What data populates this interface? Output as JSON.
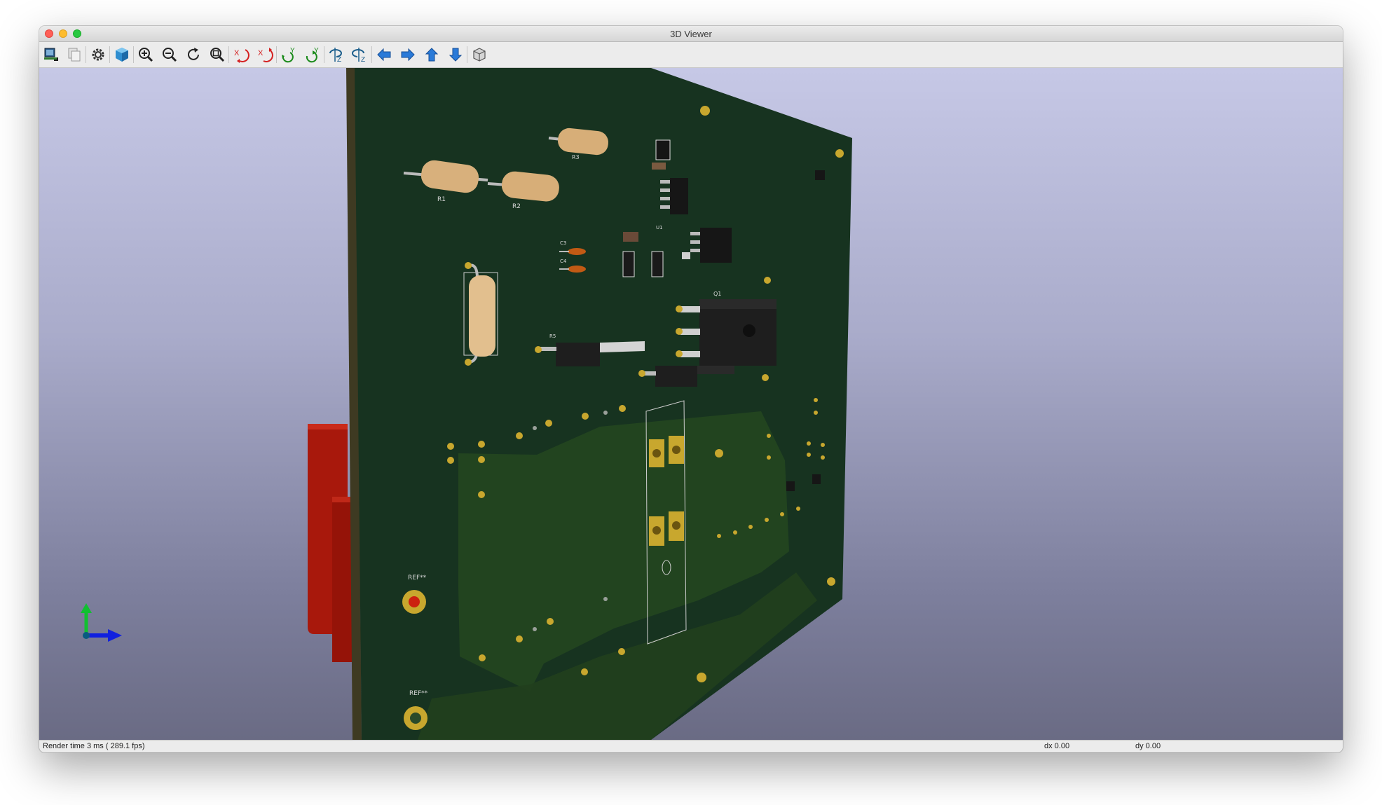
{
  "window": {
    "title": "3D Viewer"
  },
  "toolbar": {
    "buttons": [
      {
        "name": "reload-board-button",
        "icon": "reload-board-icon"
      },
      {
        "name": "copy-image-button",
        "icon": "copy-icon"
      },
      {
        "name": "preferences-button",
        "icon": "gear-icon"
      },
      {
        "name": "raytracing-button",
        "icon": "cube-render-icon"
      },
      {
        "name": "zoom-in-button",
        "icon": "zoom-in-icon"
      },
      {
        "name": "zoom-out-button",
        "icon": "zoom-out-icon"
      },
      {
        "name": "redraw-button",
        "icon": "refresh-icon"
      },
      {
        "name": "zoom-fit-button",
        "icon": "zoom-fit-icon"
      },
      {
        "name": "rotate-x-cw-button",
        "icon": "rotate-x-cw-icon"
      },
      {
        "name": "rotate-x-ccw-button",
        "icon": "rotate-x-ccw-icon"
      },
      {
        "name": "rotate-y-cw-button",
        "icon": "rotate-y-cw-icon"
      },
      {
        "name": "rotate-y-ccw-button",
        "icon": "rotate-y-ccw-icon"
      },
      {
        "name": "rotate-z-cw-button",
        "icon": "rotate-z-cw-icon"
      },
      {
        "name": "rotate-z-ccw-button",
        "icon": "rotate-z-ccw-icon"
      },
      {
        "name": "move-left-button",
        "icon": "arrow-left-icon"
      },
      {
        "name": "move-right-button",
        "icon": "arrow-right-icon"
      },
      {
        "name": "move-up-button",
        "icon": "arrow-up-icon"
      },
      {
        "name": "move-down-button",
        "icon": "arrow-down-icon"
      },
      {
        "name": "ortho-toggle-button",
        "icon": "ortho-cube-icon"
      }
    ],
    "rotate_labels": {
      "x": "X",
      "y": "Y",
      "z": "Z"
    }
  },
  "board": {
    "labels": {
      "r1": "R1",
      "r2": "R2",
      "r3": "R3",
      "r5": "R5",
      "c3": "C3",
      "c4": "C4",
      "q1": "Q1",
      "u1": "U1",
      "ref1": "REF**",
      "ref2": "REF**"
    }
  },
  "status": {
    "render_time": "Render time 3 ms ( 289.1 fps)",
    "dx": "dx 0.00",
    "dy": "dy 0.00"
  },
  "colors": {
    "board": "#173320",
    "board_edge": "#3e3a22",
    "pad_gold": "#c8a72e",
    "connector_red": "#b01c10",
    "viewport_top": "#c6c8e6",
    "viewport_bottom": "#6a6b84",
    "axis_x": "#1020e0",
    "axis_y": "#10c030",
    "axis_z": "#0a5a80"
  }
}
